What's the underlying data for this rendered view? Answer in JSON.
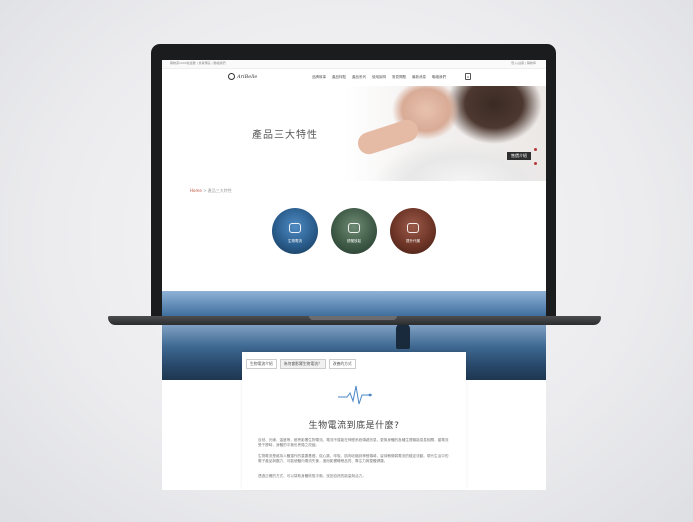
{
  "topbar": {
    "left_text": "購物滿1000免運費 | 會員專區 | 聯絡我們",
    "right_text": "登入/註冊 | 購物車"
  },
  "nav": {
    "logo_text": "AriBelle",
    "menu": [
      "品牌故事",
      "產品特點",
      "產品系列",
      "使用說明",
      "常見問題",
      "最新消息",
      "聯絡我們"
    ],
    "cart_count": "0"
  },
  "hero": {
    "title": "產品三大特性",
    "button_label": "售價介紹"
  },
  "breadcrumb": {
    "home": "Home",
    "separator": " > ",
    "current": "產品三大特性"
  },
  "features": [
    {
      "label": "生物電流"
    },
    {
      "label": "舒壓放鬆"
    },
    {
      "label": "提升代謝"
    }
  ],
  "content": {
    "tabs": [
      "生物電流介紹",
      "為何會影響生物電流？",
      "改善的方式"
    ],
    "heading": "生物電流到底是什麼?",
    "paragraphs": [
      "自然、光線、溫度等，都會影響生物電流。電流不僅能在神經系統傳遞訊息，更與身體的各種生理機能息息相關，當電流受干擾時，身體的平衡也會隨之改變。",
      "生物電流是維持人體運作的重要基礎，從心跳、呼吸、肌肉收縮到神經傳導，皆仰賴微弱電流的穩定流動。現代生活中的電子產品與壓力，可能使體內電流失衡，進而影響睡眠品質、專注力與整體健康。",
      "透過正確的方式，可以幫助身體恢復平衡，找回自然的能量與活力。"
    ]
  },
  "colors": {
    "accent": "#c0543f",
    "laptop": "#1b1c1e",
    "sea": "#2a4b6e"
  }
}
